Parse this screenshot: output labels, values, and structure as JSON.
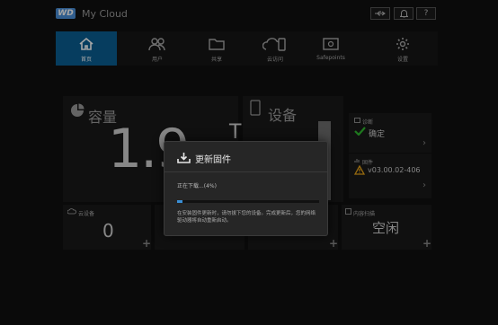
{
  "header": {
    "logo": "WD",
    "title": "My Cloud",
    "usb_icon": "usb-icon",
    "bell_icon": "bell-icon",
    "help_label": "?"
  },
  "nav": {
    "items": [
      {
        "label": "首页",
        "icon": "home-icon",
        "active": true
      },
      {
        "label": "用户",
        "icon": "users-icon",
        "active": false
      },
      {
        "label": "共享",
        "icon": "folder-icon",
        "active": false
      },
      {
        "label": "云访问",
        "icon": "cloud-access-icon",
        "active": false
      },
      {
        "label": "Safepoints",
        "icon": "safepoint-icon",
        "active": false
      },
      {
        "label": "设置",
        "icon": "gear-icon",
        "active": false
      }
    ]
  },
  "capacity": {
    "title": "容量",
    "value": "1.9",
    "unit": "TB"
  },
  "device": {
    "title": "设备"
  },
  "diagnostics": {
    "label": "诊断",
    "status": "确定"
  },
  "firmware": {
    "label": "固件",
    "version": "v03.00.02-406"
  },
  "tiles": {
    "cloud_devices": {
      "label": "云设备",
      "value": "0"
    },
    "activity": {
      "label": "内容扫描",
      "value": "空闲"
    }
  },
  "modal": {
    "title": "更新固件",
    "status": "正在下载...(4%)",
    "progress_percent": 4,
    "note": "在安装固件更新时，请勿拔下您的设备。完成更新后，您的网络驱动器将自动重新启动。"
  },
  "colors": {
    "accent": "#0a5f93",
    "progress": "#3a8fd6",
    "ok": "#2eb82e",
    "warn": "#e8a317"
  }
}
